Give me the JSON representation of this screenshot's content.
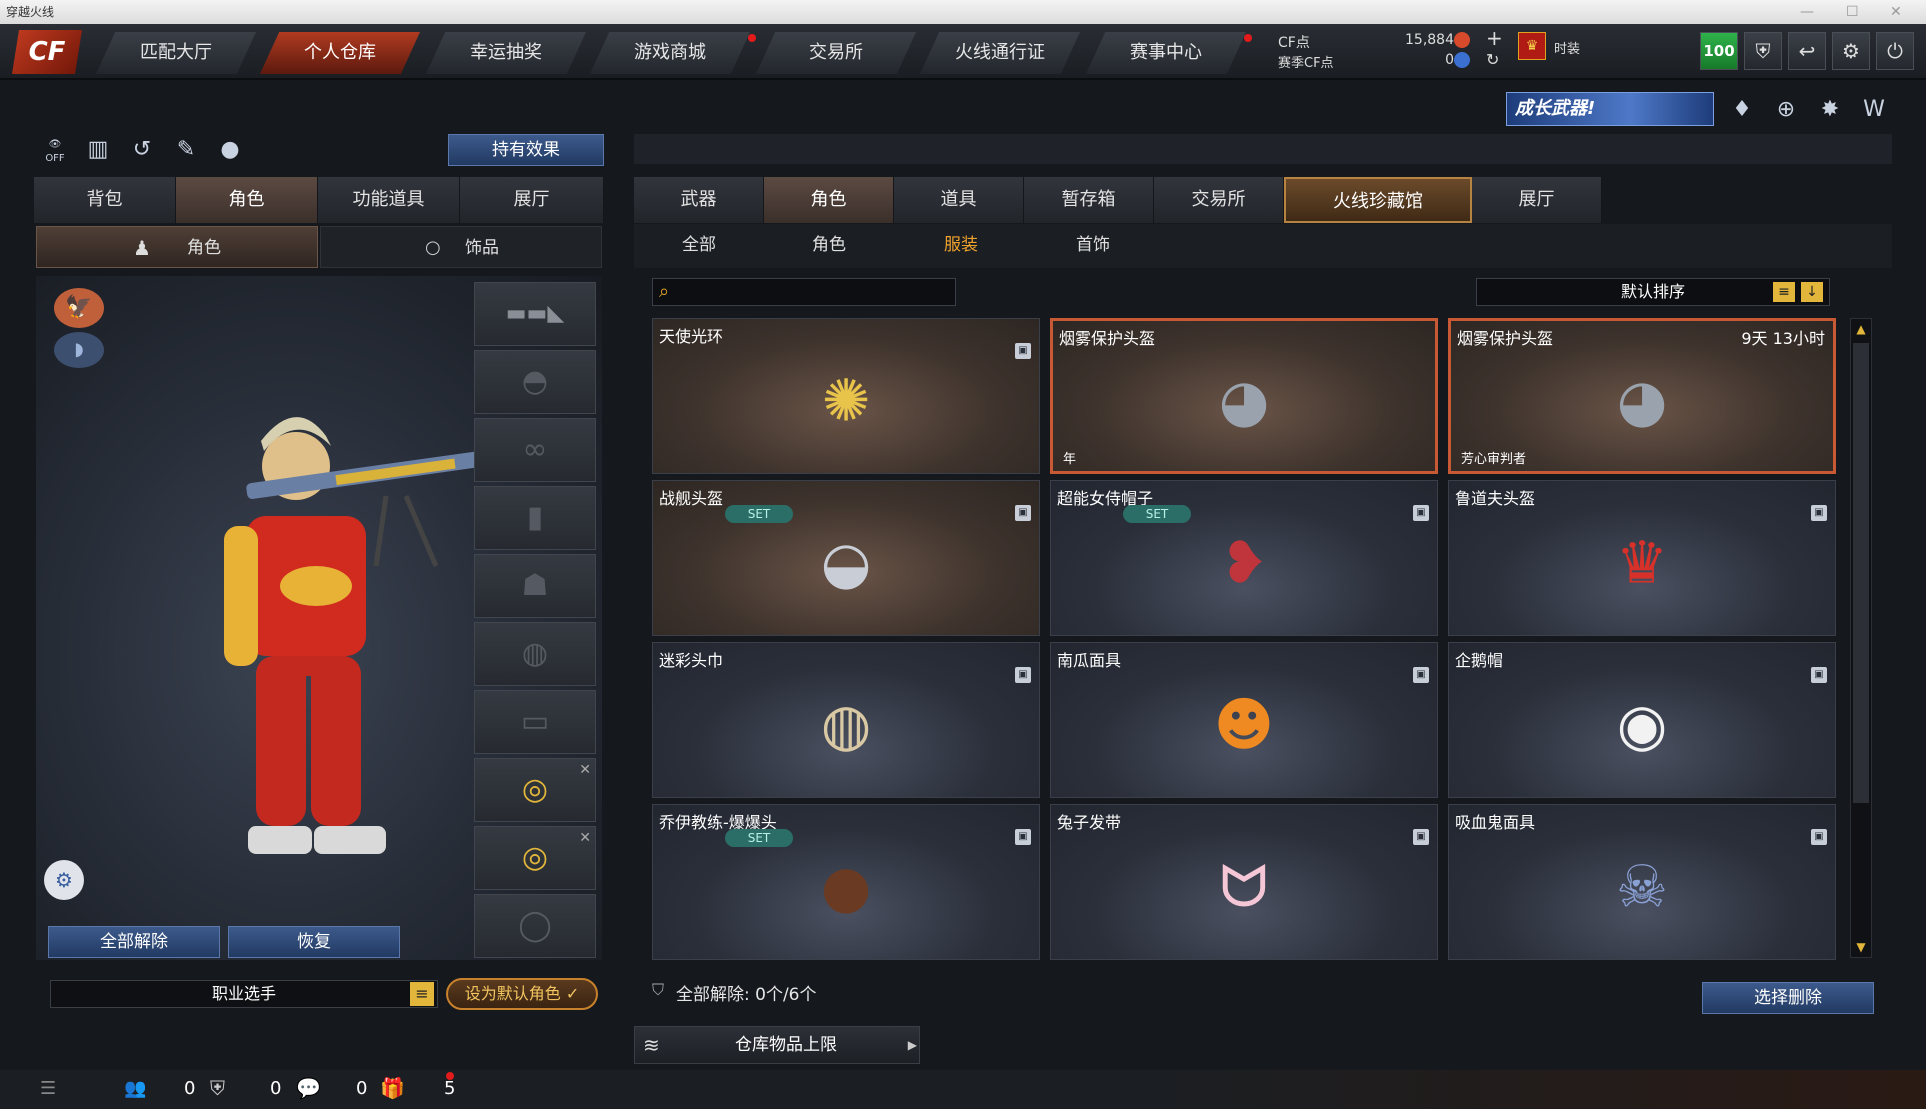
{
  "window": {
    "title": "穿越火线"
  },
  "nav": {
    "logo": "CF",
    "tabs": [
      "匹配大厅",
      "个人仓库",
      "幸运抽奖",
      "游戏商城",
      "交易所",
      "火线通行证",
      "赛事中心"
    ],
    "active_tab": "个人仓库",
    "cf_label": "CF点",
    "cf_value": "15,884",
    "season_label": "赛季CF点",
    "season_value": "0",
    "rank_label": "时装",
    "level": "100"
  },
  "banner": {
    "text": "成长武器!"
  },
  "left": {
    "effect_button": "持有效果",
    "tabs": [
      "背包",
      "角色",
      "功能道具",
      "展厅"
    ],
    "active_tab": "角色",
    "subtabs": [
      "角色",
      "饰品"
    ],
    "active_subtab": "角色",
    "off_label": "OFF",
    "clear_button": "全部解除",
    "restore_button": "恢复",
    "character_name": "职业选手",
    "default_button": "设为默认角色 ✓"
  },
  "right": {
    "tabs": [
      "武器",
      "角色",
      "道具",
      "暂存箱",
      "交易所",
      "火线珍藏馆",
      "展厅"
    ],
    "active_tab": "火线珍藏馆",
    "subtabs": [
      "全部",
      "角色",
      "服装",
      "首饰"
    ],
    "active_subtab": "服装",
    "search_placeholder": "",
    "sort_label": "默认排序",
    "items": [
      {
        "name": "天使光环",
        "icon": "halo-hair-icon",
        "set": "",
        "timer": "",
        "tag": "",
        "style": "brown",
        "selected": false
      },
      {
        "name": "烟雾保护头盔",
        "icon": "smoke-helmet-icon",
        "set": "",
        "timer": "",
        "tag": "年",
        "style": "brown",
        "selected": true
      },
      {
        "name": "烟雾保护头盔",
        "icon": "smoke-helmet-icon",
        "set": "",
        "timer": "9天 13小时",
        "tag": "芳心审判者",
        "style": "brown",
        "selected": true
      },
      {
        "name": "战舰头盔",
        "icon": "warship-helmet-icon",
        "set": "SET",
        "timer": "",
        "tag": "",
        "style": "brown",
        "selected": false
      },
      {
        "name": "超能女侍帽子",
        "icon": "maid-hat-icon",
        "set": "SET",
        "timer": "",
        "tag": "",
        "style": "blue",
        "selected": false
      },
      {
        "name": "鲁道夫头盔",
        "icon": "rudolph-helmet-icon",
        "set": "",
        "timer": "",
        "tag": "",
        "style": "blue",
        "selected": false
      },
      {
        "name": "迷彩头巾",
        "icon": "camo-bandana-icon",
        "set": "",
        "timer": "",
        "tag": "",
        "style": "blue",
        "selected": false
      },
      {
        "name": "南瓜面具",
        "icon": "pumpkin-mask-icon",
        "set": "",
        "timer": "",
        "tag": "",
        "style": "blue",
        "selected": false
      },
      {
        "name": "企鹅帽",
        "icon": "penguin-hat-icon",
        "set": "",
        "timer": "",
        "tag": "",
        "style": "blue",
        "selected": false
      },
      {
        "name": "乔伊教练-爆爆头",
        "icon": "bomb-head-icon",
        "set": "SET",
        "timer": "",
        "tag": "",
        "style": "blue",
        "selected": false
      },
      {
        "name": "兔子发带",
        "icon": "bunny-headband-icon",
        "set": "",
        "timer": "",
        "tag": "",
        "style": "blue",
        "selected": false
      },
      {
        "name": "吸血鬼面具",
        "icon": "vampire-mask-icon",
        "set": "",
        "timer": "",
        "tag": "",
        "style": "blue",
        "selected": false
      }
    ],
    "clear_all_text": "全部解除: 0个/6个",
    "delete_button": "选择删除",
    "storage_limit": "仓库物品上限"
  },
  "statusbar": {
    "counts": [
      "0",
      "0",
      "0",
      "5"
    ]
  }
}
